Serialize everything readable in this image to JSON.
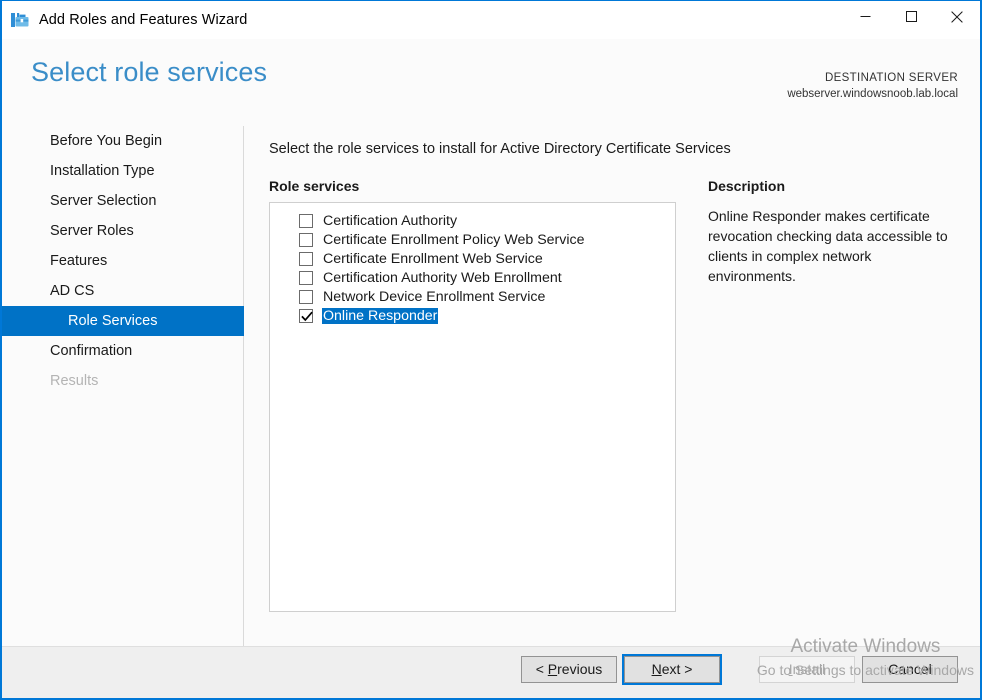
{
  "window": {
    "title": "Add Roles and Features Wizard",
    "icon": "wizard-toolbox-icon",
    "minimize_label": "Minimize",
    "maximize_label": "Maximize",
    "close_label": "Close",
    "accent_color": "#0078d7"
  },
  "header": {
    "page_title": "Select role services",
    "destination_label": "DESTINATION SERVER",
    "destination_server": "webserver.windowsnoob.lab.local",
    "title_color": "#3a8dc8"
  },
  "sidebar": {
    "items": [
      {
        "label": "Before You Begin",
        "selected": false,
        "disabled": false,
        "sub": false
      },
      {
        "label": "Installation Type",
        "selected": false,
        "disabled": false,
        "sub": false
      },
      {
        "label": "Server Selection",
        "selected": false,
        "disabled": false,
        "sub": false
      },
      {
        "label": "Server Roles",
        "selected": false,
        "disabled": false,
        "sub": false
      },
      {
        "label": "Features",
        "selected": false,
        "disabled": false,
        "sub": false
      },
      {
        "label": "AD CS",
        "selected": false,
        "disabled": false,
        "sub": false
      },
      {
        "label": "Role Services",
        "selected": true,
        "disabled": false,
        "sub": true
      },
      {
        "label": "Confirmation",
        "selected": false,
        "disabled": false,
        "sub": false
      },
      {
        "label": "Results",
        "selected": false,
        "disabled": true,
        "sub": false
      }
    ],
    "selection_color": "#0072c6"
  },
  "main": {
    "instruction": "Select the role services to install for Active Directory Certificate Services",
    "role_services_label": "Role services",
    "role_services": [
      {
        "label": "Certification Authority",
        "checked": false,
        "selected": false
      },
      {
        "label": "Certificate Enrollment Policy Web Service",
        "checked": false,
        "selected": false
      },
      {
        "label": "Certificate Enrollment Web Service",
        "checked": false,
        "selected": false
      },
      {
        "label": "Certification Authority Web Enrollment",
        "checked": false,
        "selected": false
      },
      {
        "label": "Network Device Enrollment Service",
        "checked": false,
        "selected": false
      },
      {
        "label": "Online Responder",
        "checked": true,
        "selected": true
      }
    ],
    "description_heading": "Description",
    "description_text": "Online Responder makes certificate revocation checking data accessible to clients in complex network environments."
  },
  "footer": {
    "previous_label": "< Previous",
    "previous_accel": "P",
    "next_label": "Next >",
    "next_accel": "N",
    "install_label": "Install",
    "install_accel": "I",
    "install_disabled": true,
    "cancel_label": "Cancel",
    "focused_button": "Next >"
  },
  "watermark": {
    "line1": "Activate Windows",
    "line2": "Go to Settings to activate Windows"
  }
}
